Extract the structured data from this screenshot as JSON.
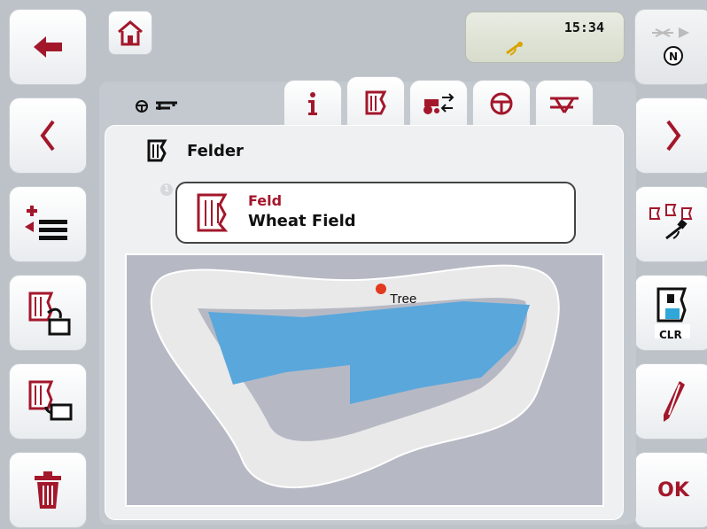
{
  "status": {
    "time": "15:34",
    "gps_icon": "gps-icon"
  },
  "tabs": [
    {
      "id": "info",
      "icon": "info-icon"
    },
    {
      "id": "fields",
      "icon": "field-icon",
      "active": true
    },
    {
      "id": "vehicles",
      "icon": "tractor-settings-icon"
    },
    {
      "id": "steering",
      "icon": "steering-wheel-icon"
    },
    {
      "id": "implement",
      "icon": "implement-icon"
    }
  ],
  "page": {
    "heading": "Felder"
  },
  "field_item": {
    "number": "1",
    "label": "Feld",
    "value": "Wheat Field"
  },
  "map": {
    "marker_label": "Tree"
  },
  "right_buttons": {
    "ok_label": "OK",
    "clr_label": "CLR"
  },
  "colors": {
    "accent": "#a3172b",
    "coverage": "#5aa7dc",
    "headland": "#e9e9ea"
  }
}
